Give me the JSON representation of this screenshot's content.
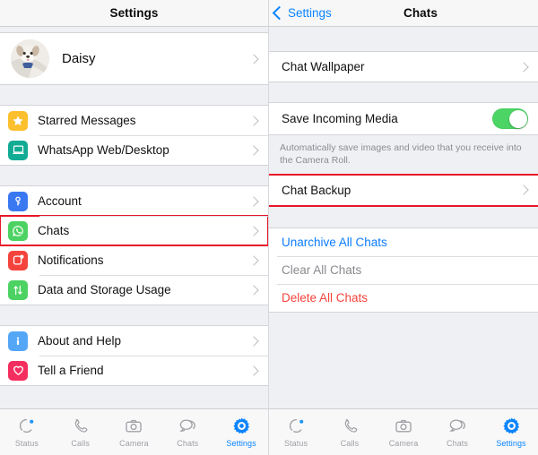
{
  "left_panel": {
    "navbar": {
      "title": "Settings"
    },
    "profile": {
      "name": "Daisy",
      "avatar_icon": "dog-photo-avatar"
    },
    "groups": [
      {
        "items": [
          {
            "label": "Starred Messages",
            "icon": "star-icon",
            "icon_color": "#fcc02e"
          },
          {
            "label": "WhatsApp Web/Desktop",
            "icon": "laptop-icon",
            "icon_color": "#12ab94"
          }
        ]
      },
      {
        "items": [
          {
            "label": "Account",
            "icon": "key-icon",
            "icon_color": "#3a78f2"
          },
          {
            "label": "Chats",
            "icon": "whatsapp-icon",
            "icon_color": "#4cd263",
            "highlighted": true
          },
          {
            "label": "Notifications",
            "icon": "notification-icon",
            "icon_color": "#f4433c"
          },
          {
            "label": "Data and Storage Usage",
            "icon": "data-usage-icon",
            "icon_color": "#4cd263"
          }
        ]
      },
      {
        "items": [
          {
            "label": "About and Help",
            "icon": "info-icon",
            "icon_color": "#54a7f7"
          },
          {
            "label": "Tell a Friend",
            "icon": "heart-icon",
            "icon_color": "#f42e5e"
          }
        ]
      }
    ]
  },
  "right_panel": {
    "navbar": {
      "back_label": "Settings",
      "title": "Chats",
      "back_icon": "chevron-left-icon"
    },
    "wallpaper_row": {
      "label": "Chat Wallpaper"
    },
    "save_media_row": {
      "label": "Save Incoming Media",
      "toggle_state": "on",
      "toggle_color": "#4cd465"
    },
    "footnote": "Automatically save images and video that you receive into the Camera Roll.",
    "chat_backup_row": {
      "label": "Chat Backup",
      "highlighted": true
    },
    "actions": [
      {
        "label": "Unarchive All Chats",
        "style": "blue-txt"
      },
      {
        "label": "Clear All Chats",
        "style": "gray-txt"
      },
      {
        "label": "Delete All Chats",
        "style": "red-txt"
      }
    ]
  },
  "tabbar": {
    "tabs": [
      {
        "label": "Status",
        "icon": "status-ring-icon"
      },
      {
        "label": "Calls",
        "icon": "phone-icon"
      },
      {
        "label": "Camera",
        "icon": "camera-icon"
      },
      {
        "label": "Chats",
        "icon": "chat-bubbles-icon"
      },
      {
        "label": "Settings",
        "icon": "gear-icon",
        "active": true
      }
    ],
    "active_color": "#0a84ff",
    "inactive_color": "#a0a0a5"
  },
  "highlight_color": "#e8162a"
}
